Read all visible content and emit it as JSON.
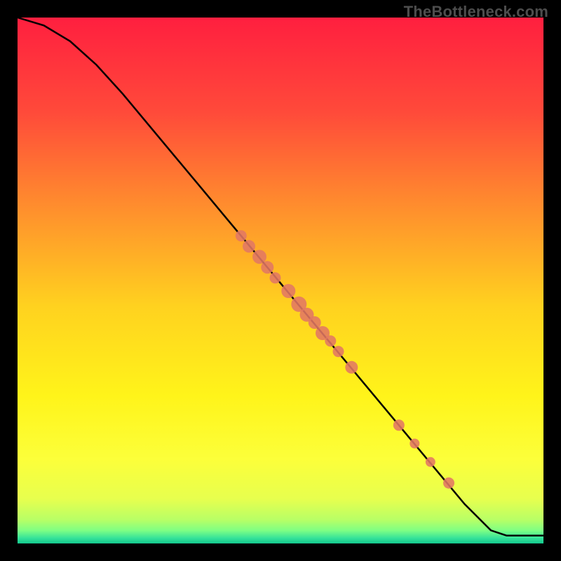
{
  "watermark": "TheBottleneck.com",
  "chart_data": {
    "type": "line",
    "title": "",
    "xlabel": "",
    "ylabel": "",
    "xlim": [
      0,
      100
    ],
    "ylim": [
      0,
      100
    ],
    "grid": false,
    "legend": false,
    "gradient_stops": [
      {
        "offset": 0.0,
        "color": "#ff1f3f"
      },
      {
        "offset": 0.18,
        "color": "#ff4a3a"
      },
      {
        "offset": 0.35,
        "color": "#ff8a2e"
      },
      {
        "offset": 0.55,
        "color": "#ffd21f"
      },
      {
        "offset": 0.72,
        "color": "#fff41a"
      },
      {
        "offset": 0.84,
        "color": "#fcff3a"
      },
      {
        "offset": 0.915,
        "color": "#e7ff4e"
      },
      {
        "offset": 0.955,
        "color": "#b8ff66"
      },
      {
        "offset": 0.975,
        "color": "#7fff83"
      },
      {
        "offset": 0.99,
        "color": "#34e29a"
      },
      {
        "offset": 1.0,
        "color": "#13c78c"
      }
    ],
    "series": [
      {
        "name": "curve",
        "color": "#000000",
        "x": [
          0,
          5,
          10,
          15,
          20,
          25,
          30,
          35,
          40,
          45,
          50,
          55,
          60,
          65,
          70,
          75,
          80,
          85,
          90,
          93,
          100
        ],
        "y": [
          100,
          98.5,
          95.5,
          91.0,
          85.5,
          79.5,
          73.5,
          67.5,
          61.5,
          55.5,
          49.5,
          43.5,
          37.5,
          31.5,
          25.5,
          19.5,
          13.5,
          7.5,
          2.5,
          1.5,
          1.5
        ]
      }
    ],
    "scatter": {
      "name": "points",
      "color": "#e27763",
      "points": [
        {
          "x": 42.5,
          "y": 58.5,
          "r": 8
        },
        {
          "x": 44.0,
          "y": 56.5,
          "r": 9
        },
        {
          "x": 46.0,
          "y": 54.5,
          "r": 10
        },
        {
          "x": 47.5,
          "y": 52.5,
          "r": 9
        },
        {
          "x": 49.0,
          "y": 50.5,
          "r": 8
        },
        {
          "x": 51.5,
          "y": 48.0,
          "r": 10
        },
        {
          "x": 53.5,
          "y": 45.5,
          "r": 11
        },
        {
          "x": 55.0,
          "y": 43.5,
          "r": 10
        },
        {
          "x": 56.5,
          "y": 42.0,
          "r": 9
        },
        {
          "x": 58.0,
          "y": 40.0,
          "r": 10
        },
        {
          "x": 59.5,
          "y": 38.5,
          "r": 8
        },
        {
          "x": 61.0,
          "y": 36.5,
          "r": 8
        },
        {
          "x": 63.5,
          "y": 33.5,
          "r": 9
        },
        {
          "x": 72.5,
          "y": 22.5,
          "r": 8
        },
        {
          "x": 75.5,
          "y": 19.0,
          "r": 7
        },
        {
          "x": 78.5,
          "y": 15.5,
          "r": 7
        },
        {
          "x": 82.0,
          "y": 11.5,
          "r": 8
        }
      ]
    }
  }
}
